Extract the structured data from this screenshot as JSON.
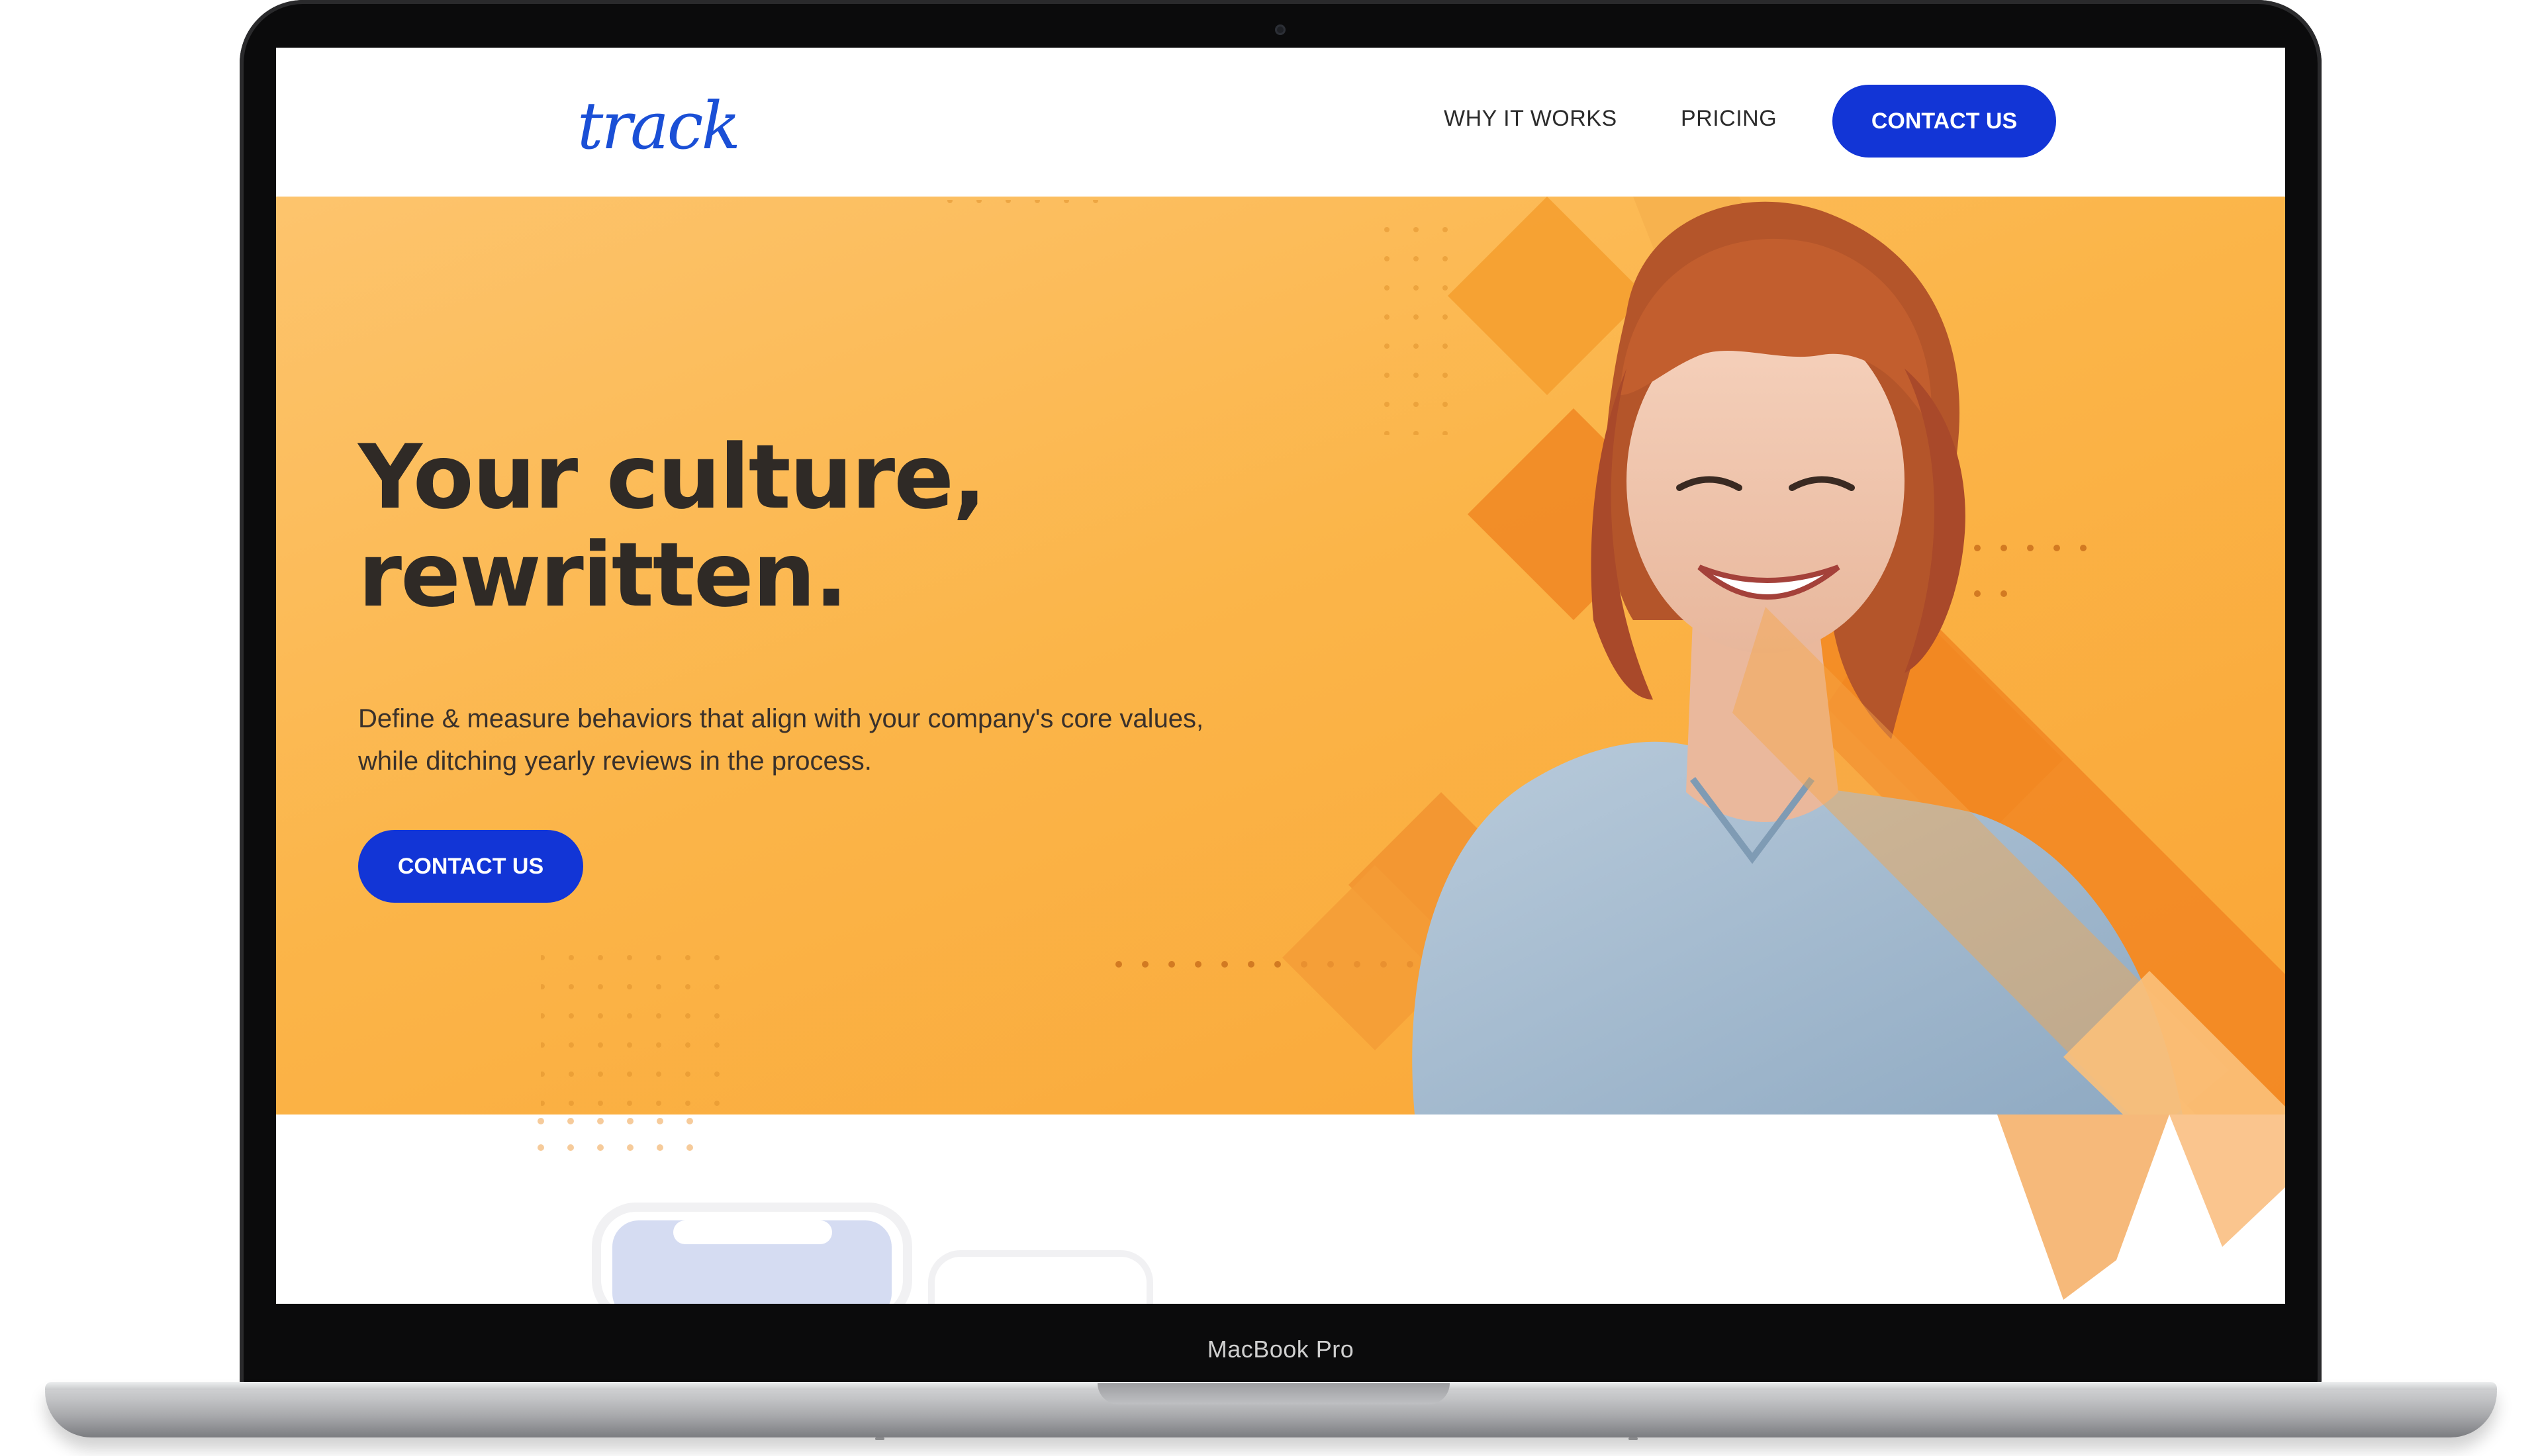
{
  "device": {
    "label": "MacBook Pro"
  },
  "nav": {
    "logo": "track",
    "links": [
      "WHY IT WORKS",
      "PRICING"
    ],
    "cta": "CONTACT US"
  },
  "hero": {
    "headline_line1": "Your culture,",
    "headline_line2": "rewritten.",
    "subtext": "Define & measure behaviors that align with your company's core values, while ditching yearly reviews in the process.",
    "cta": "CONTACT US"
  },
  "colors": {
    "brand_blue": "#1235d6",
    "hero_orange": "#fbb549",
    "accent_orange": "#f58a1f",
    "heading_text": "#2f2a26"
  },
  "icons": [
    "camera-icon",
    "woman-portrait-photo",
    "phone-mockup"
  ]
}
